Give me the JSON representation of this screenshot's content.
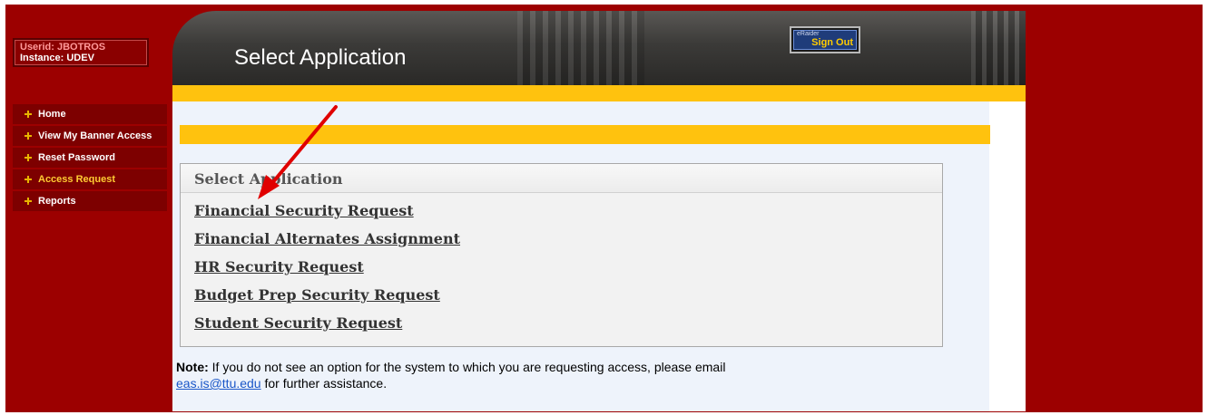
{
  "user": {
    "userid_label": "Userid:",
    "userid_value": "JBOTROS",
    "instance_label": "Instance:",
    "instance_value": "UDEV"
  },
  "nav": {
    "items": [
      {
        "label": "Home",
        "icon": "plus-icon",
        "active": false
      },
      {
        "label": "View My Banner Access",
        "icon": "plus-icon",
        "active": false
      },
      {
        "label": "Reset Password",
        "icon": "plus-icon",
        "active": false
      },
      {
        "label": "Access Request",
        "icon": "plus-icon",
        "active": true
      },
      {
        "label": "Reports",
        "icon": "plus-icon",
        "active": false
      }
    ]
  },
  "header": {
    "title": "Select Application",
    "signout_small": "eRaider",
    "signout_label": "Sign Out"
  },
  "panel": {
    "title": "Select Application",
    "links": [
      "Financial Security Request",
      "Financial Alternates Assignment",
      "HR Security Request",
      "Budget Prep Security Request",
      "Student Security Request"
    ]
  },
  "note": {
    "label": "Note:",
    "text": " If you do not see an option for the system to which you are requesting access, please email",
    "email": "eas.is@ttu.edu",
    "text_after": " for further assistance."
  },
  "colors": {
    "frame": "#9c0000",
    "gold": "#ffc20e",
    "annotation_arrow": "#e00000"
  }
}
